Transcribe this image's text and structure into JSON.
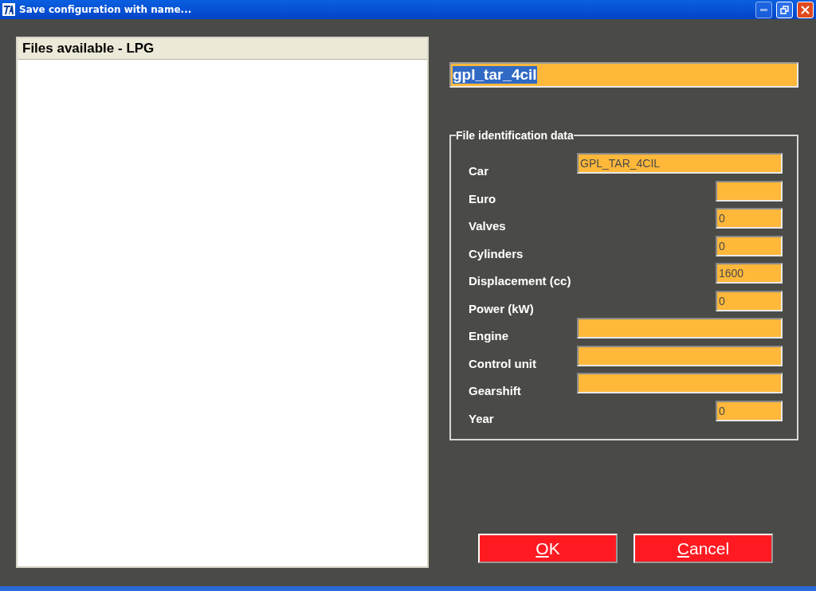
{
  "window": {
    "title": "Save configuration with name..."
  },
  "file_list": {
    "heading": "Files available - LPG"
  },
  "name_field": {
    "value": "gpl_tar_4cil",
    "selected": true
  },
  "identification": {
    "legend": "File identification data",
    "fields": [
      {
        "label": "Car",
        "value": "GPL_TAR_4CIL",
        "kind": "wide"
      },
      {
        "label": "Euro",
        "kind": "short"
      },
      {
        "label": "Valves",
        "value": "0",
        "kind": "short"
      },
      {
        "label": "Cylinders",
        "value": "0",
        "kind": "short"
      },
      {
        "label": "Displacement (cc)",
        "value": "1600",
        "kind": "short"
      },
      {
        "label": "Power (kW)",
        "value": "0",
        "kind": "short"
      },
      {
        "label": "Engine",
        "kind": "wide"
      },
      {
        "label": "Control unit",
        "kind": "wide"
      },
      {
        "label": "Gearshift",
        "kind": "wide"
      },
      {
        "label": "Year",
        "value": "0",
        "kind": "short"
      }
    ]
  },
  "buttons": [
    {
      "label": "OK",
      "access_key_underlined": true
    },
    {
      "label": "Cancel",
      "access_key_underlined": true
    }
  ]
}
